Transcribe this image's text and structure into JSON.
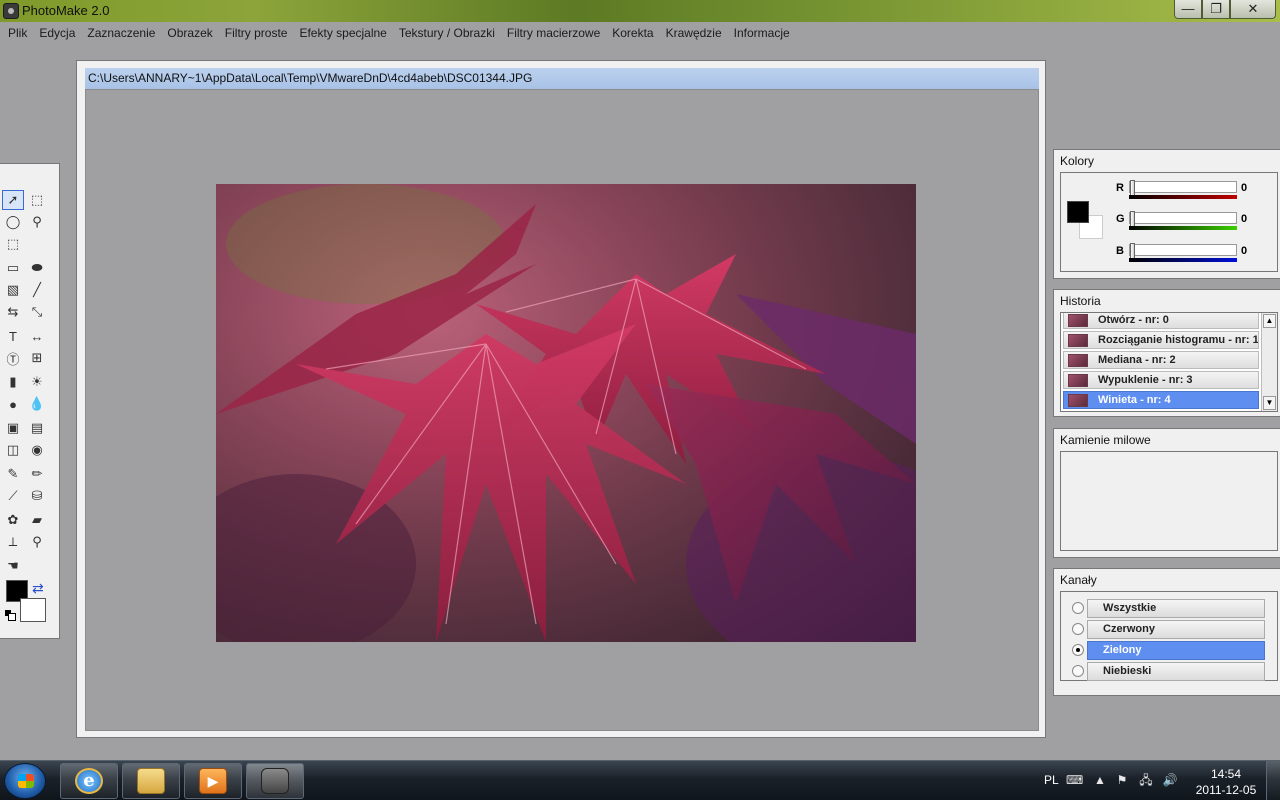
{
  "window": {
    "title": "PhotoMake 2.0",
    "min_glyph": "—",
    "max_glyph": "❐",
    "close_glyph": "✕"
  },
  "menu": [
    "Plik",
    "Edycja",
    "Zaznaczenie",
    "Obrazek",
    "Filtry proste",
    "Efekty specjalne",
    "Tekstury / Obrazki",
    "Filtry macierzowe",
    "Korekta",
    "Krawędzie",
    "Informacje"
  ],
  "document": {
    "path": "C:\\Users\\ANNARY~1\\AppData\\Local\\Temp\\VMwareDnD\\4cd4abeb\\DSC01344.JPG"
  },
  "toolbox": {
    "tools": [
      [
        "pointer-icon",
        "rect-select-icon"
      ],
      [
        "ellipse-select-icon",
        "magic-wand-icon"
      ],
      [
        "lasso-select-icon",
        ""
      ],
      [
        "rounded-rect-icon",
        "ellipse-shape-icon"
      ],
      [
        "pattern-fill-icon",
        "line-icon"
      ],
      [
        "rotate-icon",
        "resize-icon"
      ],
      [
        "text-icon",
        "measure-icon"
      ],
      [
        "text-box-icon",
        "fit-icon"
      ],
      [
        "brightness-icon",
        "sun-icon"
      ],
      [
        "sphere-icon",
        "drop-icon"
      ],
      [
        "frame-icon",
        "stamp-icon"
      ],
      [
        "mirror-icon",
        "eye-icon"
      ],
      [
        "brush-icon",
        "pencil-icon"
      ],
      [
        "knife-icon",
        "bucket-icon"
      ],
      [
        "palette-icon",
        "eraser-icon"
      ],
      [
        "eyedropper-icon",
        "zoom-icon"
      ],
      [
        "smudge-icon",
        ""
      ]
    ],
    "glyphs": {
      "pointer-icon": "➚",
      "rect-select-icon": "⬚",
      "ellipse-select-icon": "◯",
      "magic-wand-icon": "⚲",
      "lasso-select-icon": "⬚",
      "rounded-rect-icon": "▭",
      "ellipse-shape-icon": "⬬",
      "pattern-fill-icon": "▧",
      "line-icon": "╱",
      "rotate-icon": "⇆",
      "resize-icon": "⤡",
      "text-icon": "T",
      "measure-icon": "↔",
      "text-box-icon": "Ⓣ",
      "fit-icon": "⊞",
      "brightness-icon": "▮",
      "sun-icon": "☀",
      "sphere-icon": "●",
      "drop-icon": "💧",
      "frame-icon": "▣",
      "stamp-icon": "▤",
      "mirror-icon": "◫",
      "eye-icon": "◉",
      "brush-icon": "✎",
      "pencil-icon": "✏",
      "knife-icon": "⟋",
      "bucket-icon": "⛁",
      "palette-icon": "✿",
      "eraser-icon": "▰",
      "eyedropper-icon": "⟂",
      "zoom-icon": "⚲",
      "smudge-icon": "☚"
    },
    "swap_glyph": "⇄"
  },
  "colors_panel": {
    "title": "Kolory",
    "r_label": "R",
    "g_label": "G",
    "b_label": "B",
    "r_value": "0",
    "g_value": "0",
    "b_value": "0"
  },
  "history_panel": {
    "title": "Historia",
    "items": [
      "Otwórz - nr: 0",
      "Rozciąganie histogramu - nr: 1",
      "Mediana - nr: 2",
      "Wypuklenie - nr: 3",
      "Winieta - nr: 4"
    ],
    "selected_index": 4,
    "scroll_up": "▲",
    "scroll_down": "▼"
  },
  "milestones_panel": {
    "title": "Kamienie milowe"
  },
  "channels_panel": {
    "title": "Kanały",
    "items": [
      "Wszystkie",
      "Czerwony",
      "Zielony",
      "Niebieski"
    ],
    "selected_index": 2
  },
  "taskbar": {
    "ie_glyph": "e",
    "media_glyph": "▶",
    "language": "PL",
    "tray": [
      "keyboard-icon",
      "show-hidden-icon",
      "flag-icon",
      "network-icon",
      "volume-icon"
    ],
    "tray_glyphs": [
      "⌨",
      "▲",
      "⚑",
      "🖧",
      "🔊"
    ],
    "time": "14:54",
    "date": "2011-12-05"
  }
}
